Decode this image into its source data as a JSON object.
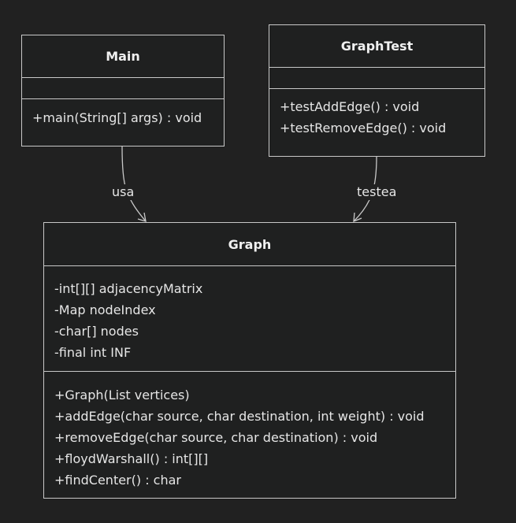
{
  "classes": {
    "main": {
      "name": "Main",
      "attributes": [],
      "methods": [
        "+main(String[] args) : void"
      ]
    },
    "graphtest": {
      "name": "GraphTest",
      "attributes": [],
      "methods": [
        "+testAddEdge() : void",
        "+testRemoveEdge() : void"
      ]
    },
    "graph": {
      "name": "Graph",
      "attributes": [
        "-int[][] adjacencyMatrix",
        "-Map nodeIndex",
        "-char[] nodes",
        "-final int INF"
      ],
      "methods": [
        "+Graph(List vertices)",
        "+addEdge(char source, char destination, int weight) : void",
        "+removeEdge(char source, char destination) : void",
        "+floydWarshall() : int[][]",
        "+findCenter() : char"
      ]
    }
  },
  "relations": [
    {
      "from": "Main",
      "to": "Graph",
      "label": "usa"
    },
    {
      "from": "GraphTest",
      "to": "Graph",
      "label": "testea"
    }
  ],
  "colors": {
    "background": "#212121",
    "box_fill": "#1f2020",
    "border": "#c8c8c8",
    "text": "#e6e6e6"
  }
}
